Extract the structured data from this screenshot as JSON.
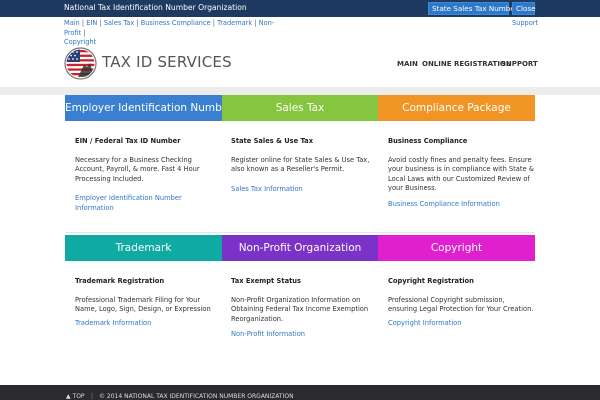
{
  "topbar": {
    "title": "National Tax Identification Number Organization",
    "state_button": "State Sales Tax Number",
    "close_button": "Close"
  },
  "breadcrumbs": {
    "items": [
      "Main",
      "EIN",
      "Sales Tax",
      "Business Compliance",
      "Trademark",
      "Non-Profit",
      "Copyright"
    ],
    "separator": "|"
  },
  "support_link": "Support",
  "logo": {
    "text": "TAX ID SERVICES",
    "icon": "us-flag-seal-icon"
  },
  "nav": {
    "items": [
      "MAIN",
      "ONLINE REGISTRATION",
      "SUPPORT"
    ]
  },
  "tiles": [
    {
      "label": "Employer Identification Number",
      "color": "#3a7fd0"
    },
    {
      "label": "Sales Tax",
      "color": "#86c540"
    },
    {
      "label": "Compliance Package",
      "color": "#ef9425"
    },
    {
      "label": "Trademark",
      "color": "#0faaa2"
    },
    {
      "label": "Non-Profit Organization",
      "color": "#7a32c8"
    },
    {
      "label": "Copyright",
      "color": "#e020cf"
    }
  ],
  "sections": [
    {
      "heading": "EIN / Federal Tax ID Number",
      "body": "Necessary for a Business Checking Account, Payroll, & more. Fast 4 Hour Processing Included.",
      "link": "Employer Identification Number Information"
    },
    {
      "heading": "State Sales & Use Tax",
      "body": "Register online for State Sales & Use Tax, also known as a Reseller's Permit.",
      "link": "Sales Tax Information"
    },
    {
      "heading": "Business Compliance",
      "body": "Avoid costly fines and penalty fees. Ensure your business is in compliance with State & Local Laws with our Customized Review of your Business.",
      "link": "Business Compliance Information"
    },
    {
      "heading": "Trademark Registration",
      "body": "Professional Trademark Filing for Your Name, Logo, Sign, Design, or Expression",
      "link": "Trademark Information"
    },
    {
      "heading": "Tax Exempt Status",
      "body": "Non-Profit Organization Information on Obtaining Federal Tax Income Exemption Reorganization.",
      "link": "Non-Profit Information"
    },
    {
      "heading": "Copyright Registration",
      "body": "Professional Copyright submission, ensuring Legal Protection for Your Creation.",
      "link": "Copyright Information"
    }
  ],
  "footer": {
    "top_link": "TOP",
    "copyright": "© 2014 NATIONAL TAX IDENTIFICATION NUMBER ORGANIZATION"
  }
}
